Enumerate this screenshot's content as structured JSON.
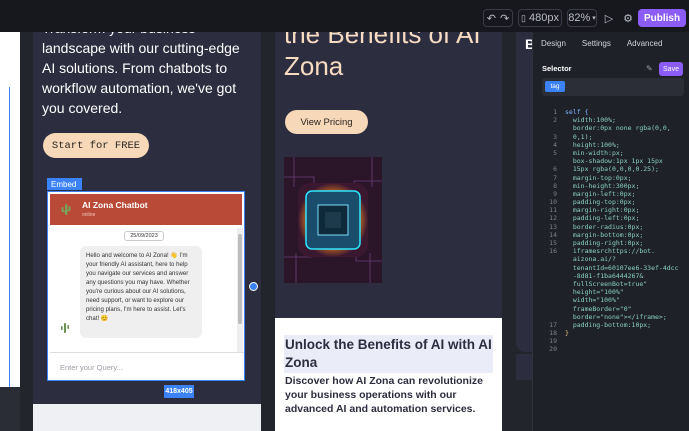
{
  "toolbar": {
    "undo_icon": "undo-icon",
    "redo_icon": "redo-icon",
    "device_label": "480px",
    "zoom_label": "82%",
    "publish_label": "Publish"
  },
  "canvas": {
    "col1": {
      "hero_text": "Transform your business landscape with our cutting-edge AI solutions. From chatbots to workflow automation, we've got you covered.",
      "start_button": "Start for FREE",
      "embed_label": "Embed",
      "chatbot": {
        "title": "AI Zona Chatbot",
        "status": "online",
        "date": "25/09/2023",
        "message": "Hello and welcome to AI Zona! 👋 I'm your friendly AI assistant, here to help you navigate our services and answer any questions you may have. Whether you're curious about our AI solutions, need support, or want to explore our pricing plans, I'm here to assist. Let's chat! 😊",
        "input_placeholder": "Enter your Query..."
      },
      "size_badge": "418x405"
    },
    "col2": {
      "headline": "the Benefits of AI Zona",
      "pricing_button": "View Pricing",
      "unlock_title": "Unlock the Benefits of AI with AI Zona",
      "unlock_desc": "Discover how AI Zona can revolutionize your business operations with our advanced AI and automation services."
    },
    "col3": {
      "letter": "B"
    }
  },
  "panel": {
    "tabs": [
      "Design",
      "Settings",
      "Advanced"
    ],
    "selector_label": "Selector",
    "save_label": "Save",
    "selected_tag": "tag",
    "line_numbers": [
      "1",
      "2",
      "3",
      "4",
      "5",
      "6",
      "7",
      "8",
      "9",
      "10",
      "11",
      "12",
      "13",
      "14",
      "15",
      "16",
      "17",
      "18",
      "19",
      "20"
    ],
    "code_lines": [
      "self {",
      "  width:100%;",
      "  border:0px none rgba(0,0,",
      "  0,1);",
      "  height:100%;",
      "  min-width:px;",
      "  box-shadow:1px 1px 15px",
      "  15px rgba(0,0,0,0.25);",
      "  margin-top:0px;",
      "  min-height:300px;",
      "  margin-left:0px;",
      "  padding-top:0px;",
      "  margin-right:0px;",
      "  padding-left:0px;",
      "  border-radius:0px;",
      "  margin-bottom:0px;",
      "  padding-right:0px;",
      "  iframesrchttps://bot.",
      "  aizona.ai/?",
      "  tenantId=60107ee6-33ef-4dcc",
      "  -8d81-f1ba6444267&",
      "  fullScreenBot=true\"",
      "  height=\"100%\"",
      "  width=\"100%\"",
      "  frameBorder=\"0\"",
      "  border=\"none\"></iframe>;",
      "  padding-bottom:10px;",
      "}",
      "",
      ""
    ]
  },
  "colors": {
    "accent": "#8b5cf6",
    "selection": "#3b82f6",
    "cta": "#f7d8b8",
    "chat_header": "#b84a37"
  }
}
